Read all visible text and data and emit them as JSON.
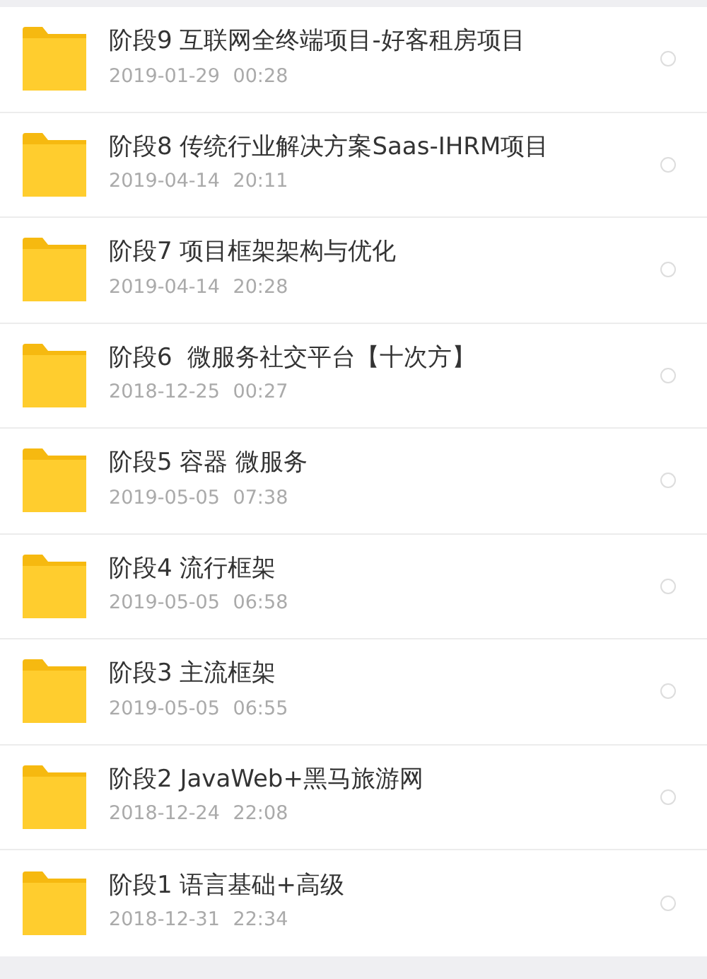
{
  "files": [
    {
      "name": "阶段9 互联网全终端项目-好客租房项目",
      "modified": "2019-01-29 00:28",
      "selected": false
    },
    {
      "name": "阶段8 传统行业解决方案Saas-IHRM项目",
      "modified": "2019-04-14 20:11",
      "selected": false
    },
    {
      "name": "阶段7 项目框架架构与优化",
      "modified": "2019-04-14 20:28",
      "selected": false
    },
    {
      "name": "阶段6  微服务社交平台【十次方】",
      "modified": "2018-12-25 00:27",
      "selected": false
    },
    {
      "name": "阶段5 容器 微服务",
      "modified": "2019-05-05 07:38",
      "selected": false
    },
    {
      "name": "阶段4 流行框架",
      "modified": "2019-05-05 06:58",
      "selected": false
    },
    {
      "name": "阶段3 主流框架",
      "modified": "2019-05-05 06:55",
      "selected": false
    },
    {
      "name": "阶段2 JavaWeb+黑马旅游网",
      "modified": "2018-12-24 22:08",
      "selected": false
    },
    {
      "name": "阶段1 语言基础+高级",
      "modified": "2018-12-31 22:34",
      "selected": false
    }
  ]
}
